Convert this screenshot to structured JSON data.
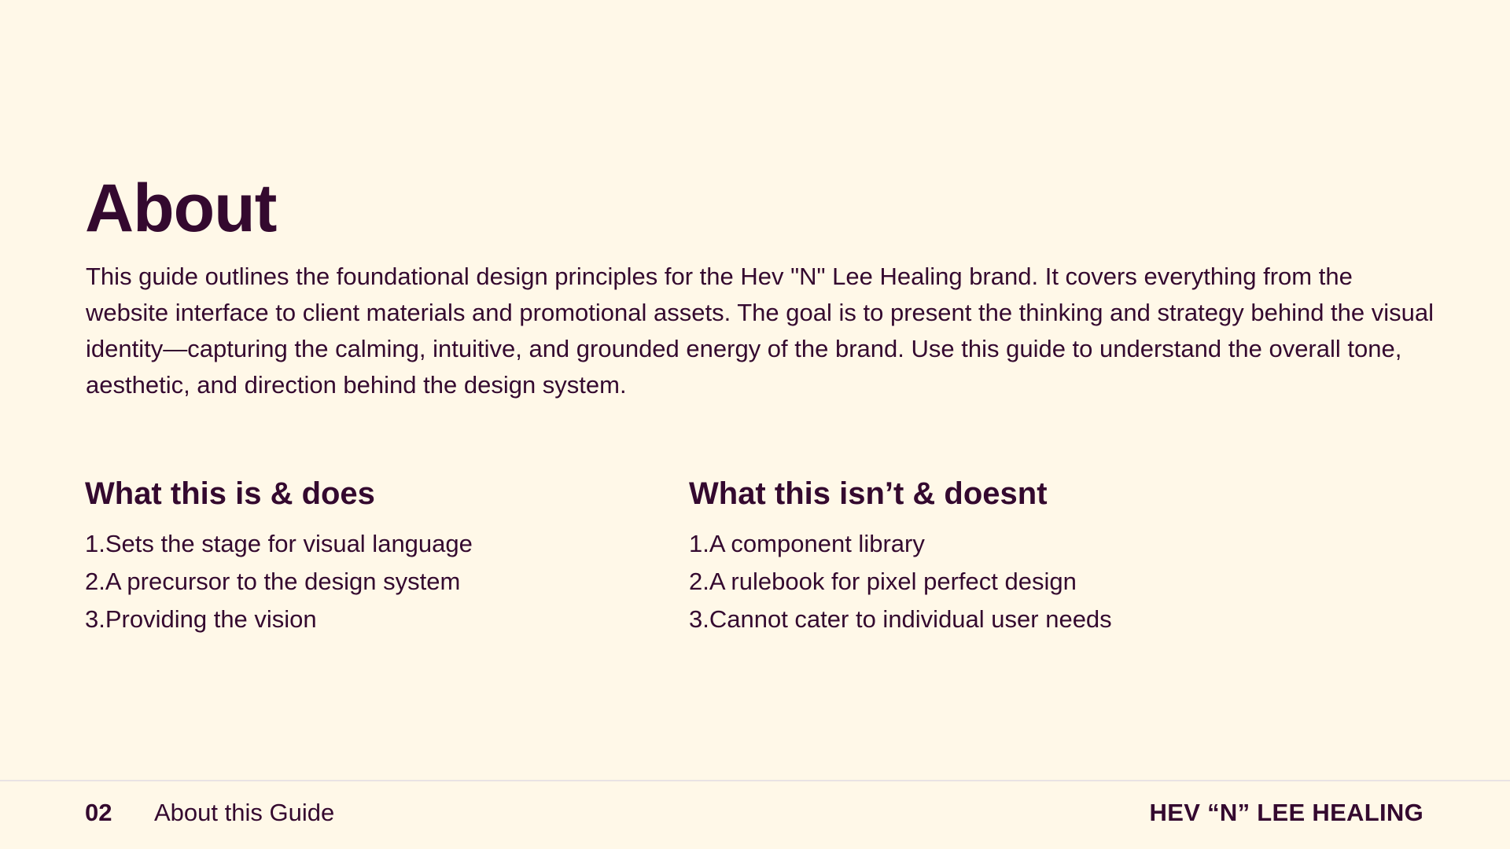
{
  "title": "About",
  "intro": "This guide outlines the foundational design principles for the Hev \"N\" Lee Healing brand. It covers everything from the website interface to client materials and promotional assets. The goal is to present the thinking and strategy behind the visual identity—capturing the calming, intuitive, and grounded energy of the brand. Use this guide to understand the overall tone, aesthetic, and direction behind the design system.",
  "is_does": {
    "heading": "What this is & does",
    "items": [
      "1.Sets the stage for visual language",
      "2.A precursor to the design system",
      "3.Providing the vision"
    ]
  },
  "isnt_doesnt": {
    "heading": "What this isn’t & doesnt",
    "items": [
      "1.A component library",
      "2.A rulebook for pixel perfect design",
      "3.Cannot cater to individual user needs"
    ]
  },
  "footer": {
    "page_number": "02",
    "section": "About this Guide",
    "brand": "HEV “N” LEE HEALING"
  },
  "colors": {
    "background": "#FFF8E8",
    "text": "#34092F",
    "divider": "#E9E3E4"
  }
}
